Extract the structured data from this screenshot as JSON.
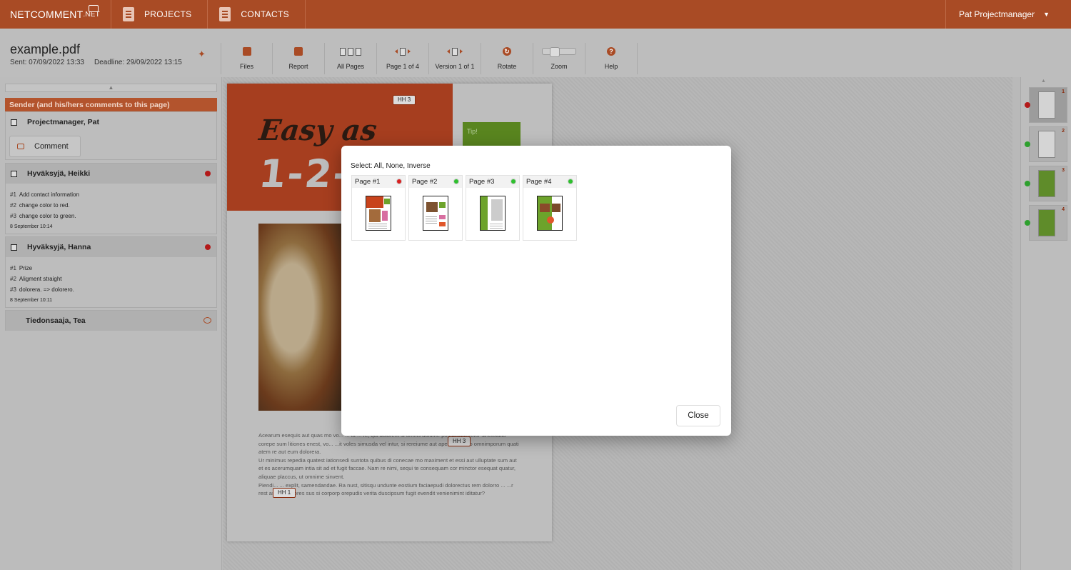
{
  "nav": {
    "brand": "NETCOMMENT",
    "brand_suffix": ".NET",
    "projects": "PROJECTS",
    "contacts": "CONTACTS",
    "user": "Pat Projectmanager",
    "user_caret": "▼"
  },
  "file": {
    "name": "example.pdf",
    "sent": "Sent: 07/09/2022 13:33",
    "deadline": "Deadline: 29/09/2022 13:15"
  },
  "toolbar": {
    "files": "Files",
    "report": "Report",
    "all_pages": "All Pages",
    "page": "Page 1 of 4",
    "version": "Version 1 of 1",
    "rotate": "Rotate",
    "zoom": "Zoom",
    "help": "Help"
  },
  "sidebar": {
    "sender_header": "Sender (and his/hers comments to this page)",
    "sender_name": "Projectmanager, Pat",
    "comment_button": "Comment",
    "reviewers": [
      {
        "name": "Hyväksyjä, Heikki",
        "status_color": "#b31919",
        "comments": [
          {
            "num": "#1",
            "text": "Add contact information"
          },
          {
            "num": "#2",
            "text": "change color to red."
          },
          {
            "num": "#3",
            "text": "change color to green."
          }
        ],
        "time": "8 September 10:14"
      },
      {
        "name": "Hyväksyjä, Hanna",
        "status_color": "#b31919",
        "comments": [
          {
            "num": "#1",
            "text": "Prize"
          },
          {
            "num": "#2",
            "text": "Aligment straight"
          },
          {
            "num": "#3",
            "text": "dolorera. => dolorero."
          }
        ],
        "time": "8 September 10:11"
      }
    ],
    "recipient": "Tiedonsaaja, Tea"
  },
  "document": {
    "title_line1": "Easy as",
    "title_line2": "1-2-",
    "tip": "Tip!",
    "body_p1": "Acearum esequis aut quas mo vo... ... ut ... re, qui dolorem si omnis dolume pos verum volor sinctotatio corepe sum litiones enest, vo... ...it voles simusda vel intur, si rereiume aut apedis et vero omnimporum quati atem re aut eum dolorera.",
    "body_p2": "Ur minimus repedia quatest iationsedi suntota quibus di conecae mo maximent et essi aut ulluptate sum aut et es acerumquam intia sit ad et fugit faccae. Nam re nimi, sequi te consequam cor minctor esequat quatur, aliquae placcus, ut omnime sinvent.",
    "body_p3": "Piendi... ... explit, samendandae. Ra nust, sitisqu undunte eostium faciaepudi dolorectus rem dolorro ... ...r rest asped maiores sus si corporp orepudis verita duscipsum fugit evendit venienimint iditatur?",
    "markers": [
      "HH 3",
      "HH 3",
      "HH 1"
    ]
  },
  "thumbnails": [
    {
      "num": "1",
      "status": "#b31919"
    },
    {
      "num": "2",
      "status": "#2ea02e"
    },
    {
      "num": "3",
      "status": "#2ea02e"
    },
    {
      "num": "4",
      "status": "#2ea02e"
    }
  ],
  "modal": {
    "select_label": "Select: All, None, Inverse",
    "pages": [
      {
        "label": "Page #1",
        "status": "#d92020"
      },
      {
        "label": "Page #2",
        "status": "#2ec02e"
      },
      {
        "label": "Page #3",
        "status": "#2ec02e"
      },
      {
        "label": "Page #4",
        "status": "#2ec02e"
      }
    ],
    "close": "Close"
  },
  "colors": {
    "brand": "#a94b25",
    "approved": "#2ec02e",
    "rejected": "#d92020"
  }
}
